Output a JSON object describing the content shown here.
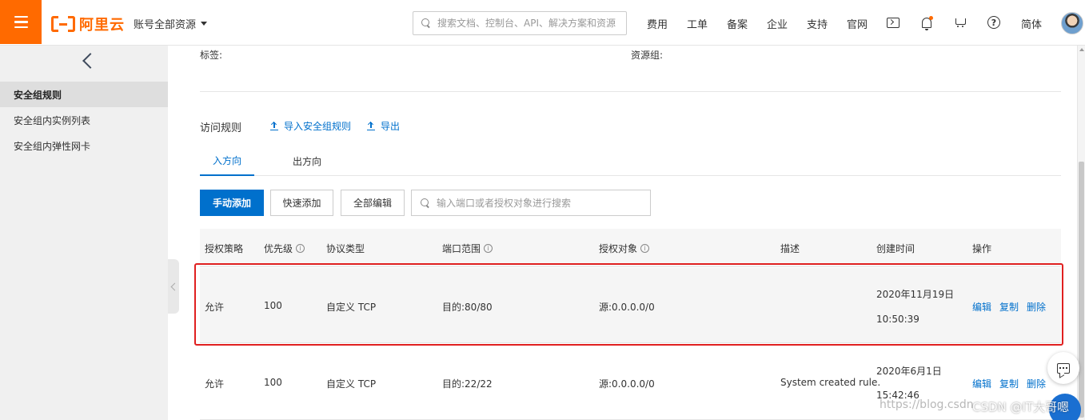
{
  "header": {
    "logo_text": "阿里云",
    "account": "账号全部资源",
    "search_placeholder": "搜索文档、控制台、API、解决方案和资源",
    "nav": [
      "费用",
      "工单",
      "备案",
      "企业",
      "支持",
      "官网"
    ],
    "lang": "简体",
    "icons": [
      "terminal-icon",
      "bell-icon",
      "cart-icon",
      "help-icon"
    ],
    "accent_color": "#ff6a00"
  },
  "sidebar": {
    "items": [
      {
        "label": "安全组规则",
        "active": true
      },
      {
        "label": "安全组内实例列表",
        "active": false
      },
      {
        "label": "安全组内弹性网卡",
        "active": false
      }
    ]
  },
  "main": {
    "tag_label": "标签:",
    "resource_group_label": "资源组:",
    "section_title": "访问规则",
    "import_link": "导入安全组规则",
    "export_link": "导出",
    "tabs": [
      {
        "label": "入方向",
        "active": true
      },
      {
        "label": "出方向",
        "active": false
      }
    ],
    "buttons": {
      "manual_add": "手动添加",
      "quick_add": "快速添加",
      "edit_all": "全部编辑"
    },
    "filter_placeholder": "输入端口或者授权对象进行搜索",
    "table": {
      "columns": [
        "授权策略",
        "优先级",
        "协议类型",
        "端口范围",
        "授权对象",
        "描述",
        "创建时间",
        "操作"
      ],
      "rows": [
        {
          "policy": "允许",
          "priority": "100",
          "protocol": "自定义 TCP",
          "port": "目的:80/80",
          "source": "源:0.0.0.0/0",
          "desc": "",
          "date": "2020年11月19日",
          "time": "10:50:39",
          "ops": [
            "编辑",
            "复制",
            "删除"
          ]
        },
        {
          "policy": "允许",
          "priority": "100",
          "protocol": "自定义 TCP",
          "port": "目的:22/22",
          "source": "源:0.0.0.0/0",
          "desc": "System created rule.",
          "date": "2020年6月1日",
          "time": "15:42:46",
          "ops": [
            "编辑",
            "复制",
            "删除"
          ]
        }
      ]
    },
    "primary_color": "#0070cc"
  },
  "watermark": {
    "url": "https://blog.csdn",
    "brand": "CSDN @IT大哥嗯"
  }
}
